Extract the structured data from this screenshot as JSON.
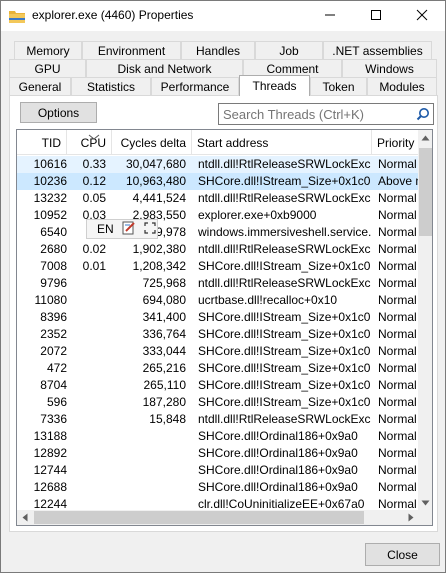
{
  "window": {
    "title": "explorer.exe (4460) Properties",
    "icon": "folder-icon",
    "controls": [
      "minimize-icon",
      "maximize-icon",
      "close-icon"
    ]
  },
  "tabs": {
    "row1": [
      "Memory",
      "Environment",
      "Handles",
      "Job",
      ".NET assemblies"
    ],
    "row2": [
      "GPU",
      "Disk and Network",
      "Comment",
      "Windows"
    ],
    "row3": [
      "General",
      "Statistics",
      "Performance",
      "Threads",
      "Token",
      "Modules"
    ],
    "active": "Threads"
  },
  "toolbar": {
    "options_label": "Options",
    "search_placeholder": "Search Threads (Ctrl+K)"
  },
  "table": {
    "columns": [
      "TID",
      "CPU",
      "Cycles delta",
      "Start address",
      "Priority"
    ],
    "sort_column": "CPU",
    "rows": [
      [
        "10616",
        "0.33",
        "30,047,680",
        "ntdll.dll!RtlReleaseSRWLockExcl...",
        "Normal"
      ],
      [
        "10236",
        "0.12",
        "10,963,480",
        "SHCore.dll!IStream_Size+0x1c0",
        "Above n"
      ],
      [
        "13232",
        "0.05",
        "4,441,524",
        "ntdll.dll!RtlReleaseSRWLockExcl...",
        "Normal"
      ],
      [
        "10952",
        "0.03",
        "2,983,550",
        "explorer.exe+0xb9000",
        "Normal"
      ],
      [
        "6540",
        "",
        "9,978",
        "windows.immersiveshell.service....",
        "Normal"
      ],
      [
        "2680",
        "0.02",
        "1,902,380",
        "ntdll.dll!RtlReleaseSRWLockExcl...",
        "Normal"
      ],
      [
        "7008",
        "0.01",
        "1,208,342",
        "SHCore.dll!IStream_Size+0x1c0",
        "Normal"
      ],
      [
        "9796",
        "",
        "725,968",
        "ntdll.dll!RtlReleaseSRWLockExcl...",
        "Normal"
      ],
      [
        "11080",
        "",
        "694,080",
        "ucrtbase.dll!recalloc+0x10",
        "Normal"
      ],
      [
        "8396",
        "",
        "341,400",
        "SHCore.dll!IStream_Size+0x1c0",
        "Normal"
      ],
      [
        "2352",
        "",
        "336,764",
        "SHCore.dll!IStream_Size+0x1c0",
        "Normal"
      ],
      [
        "2072",
        "",
        "333,044",
        "SHCore.dll!IStream_Size+0x1c0",
        "Normal"
      ],
      [
        "472",
        "",
        "265,216",
        "SHCore.dll!IStream_Size+0x1c0",
        "Normal"
      ],
      [
        "8704",
        "",
        "265,110",
        "SHCore.dll!IStream_Size+0x1c0",
        "Normal"
      ],
      [
        "596",
        "",
        "187,280",
        "SHCore.dll!IStream_Size+0x1c0",
        "Normal"
      ],
      [
        "7336",
        "",
        "15,848",
        "ntdll.dll!RtlReleaseSRWLockExcl...",
        "Normal"
      ],
      [
        "13188",
        "",
        "",
        "SHCore.dll!Ordinal186+0x9a0",
        "Normal"
      ],
      [
        "12892",
        "",
        "",
        "SHCore.dll!Ordinal186+0x9a0",
        "Normal"
      ],
      [
        "12744",
        "",
        "",
        "SHCore.dll!Ordinal186+0x9a0",
        "Normal"
      ],
      [
        "12688",
        "",
        "",
        "SHCore.dll!Ordinal186+0x9a0",
        "Normal"
      ],
      [
        "12244",
        "",
        "",
        "clr.dll!CoUninitializeEE+0x67a0",
        "Normal"
      ]
    ],
    "selected_row": 1,
    "highlighted_row": 0
  },
  "ime_popup": {
    "lang": "EN"
  },
  "footer": {
    "close_label": "Close"
  },
  "colors": {
    "selection": "#cce8ff",
    "highlight": "#e5f3ff",
    "folder": "#e8b33a"
  }
}
